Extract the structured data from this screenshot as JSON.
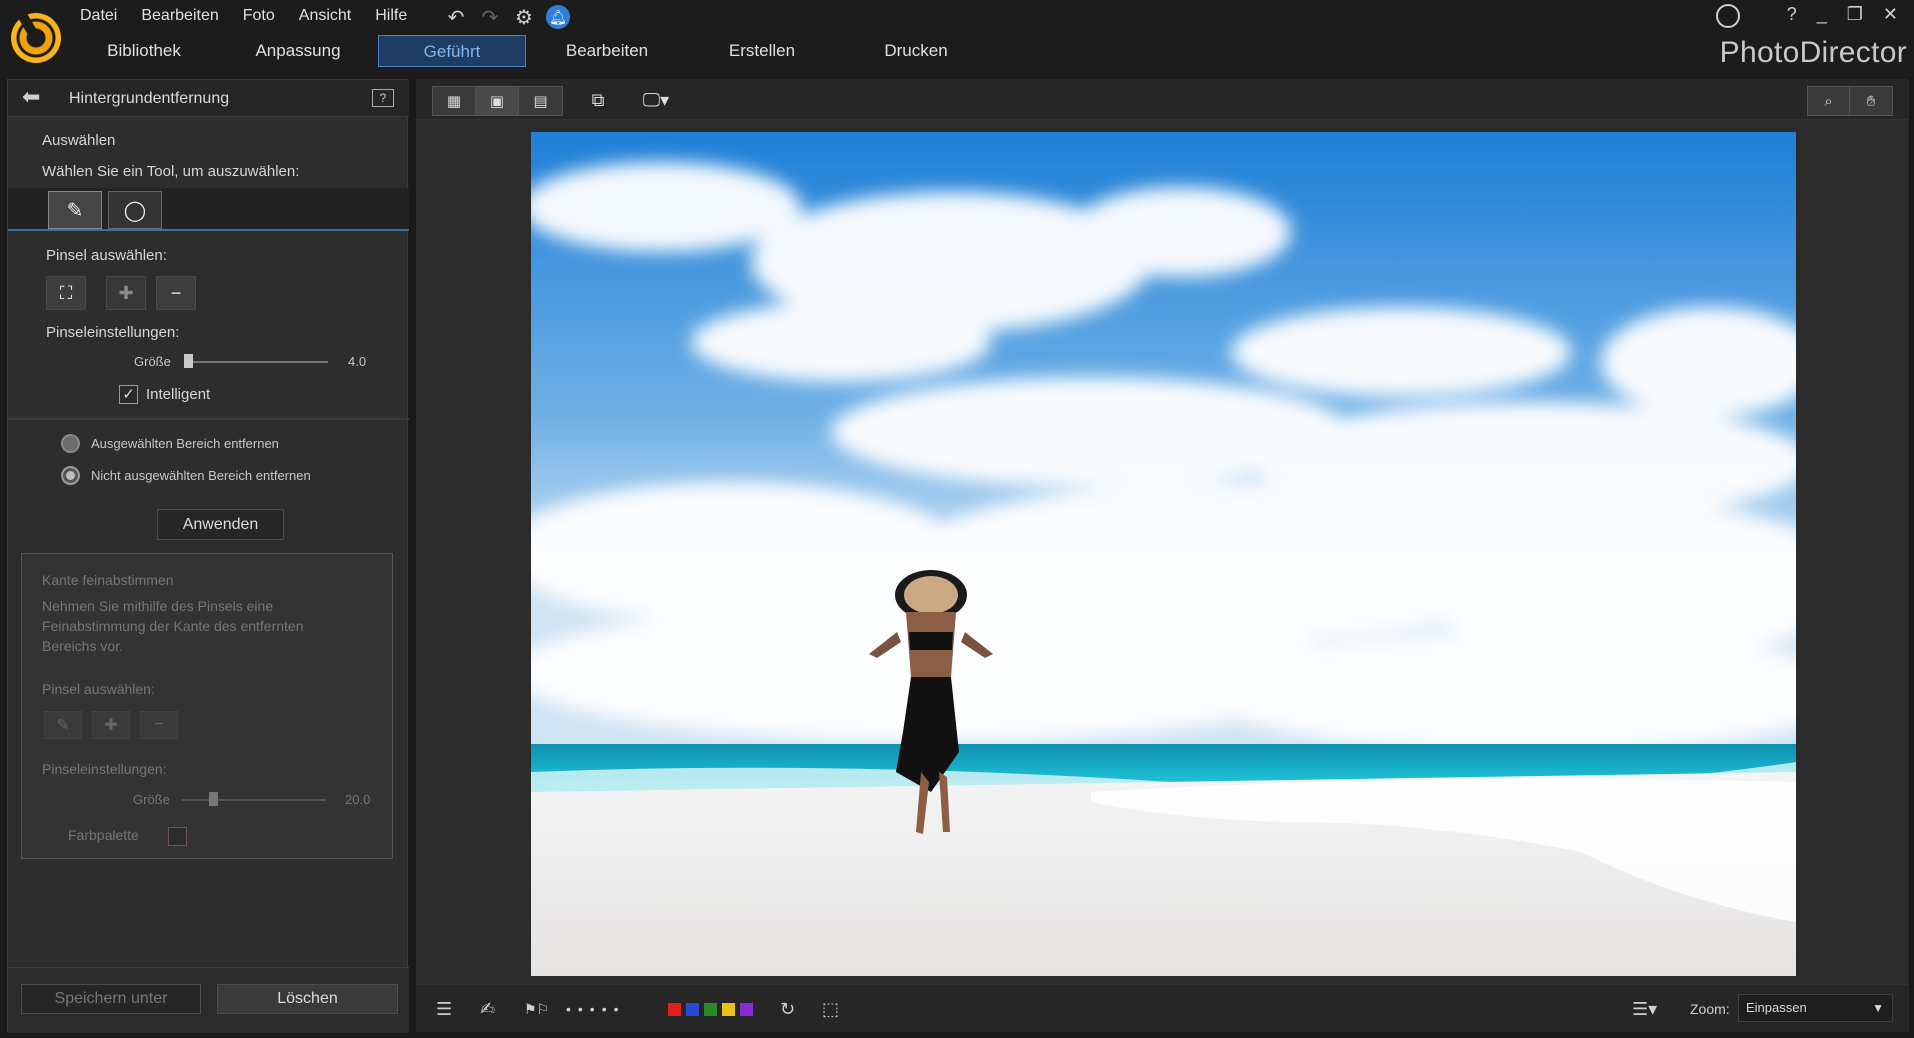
{
  "menu": [
    "Datei",
    "Bearbeiten",
    "Foto",
    "Ansicht",
    "Hilfe"
  ],
  "tabs": [
    "Bibliothek",
    "Anpassung",
    "Geführt",
    "Bearbeiten",
    "Erstellen",
    "Drucken"
  ],
  "active_tab": "Geführt",
  "brand": "PhotoDirector",
  "window_controls": [
    "?",
    "_",
    "❐",
    "✕"
  ],
  "panel": {
    "title": "Hintergrundentfernung",
    "select_heading": "Auswählen",
    "select_prompt": "Wählen Sie ein Tool, um auszuwählen:",
    "brush_select_label": "Pinsel auswählen:",
    "brush_settings_label": "Pinseleinstellungen:",
    "size_label": "Größe",
    "size_value": "4.0",
    "size_fraction": 0.0,
    "intelligent_label": "Intelligent",
    "intelligent_checked": true,
    "radio_remove_selected": "Ausgewählten Bereich entfernen",
    "radio_remove_unselected": "Nicht ausgewählten Bereich entfernen",
    "radio_selected": "remove_unselected",
    "apply_label": "Anwenden",
    "refine": {
      "title": "Kante feinabstimmen",
      "description": "Nehmen Sie mithilfe des Pinsels eine Feinabstimmung der Kante des entfernten Bereichs vor.",
      "brush_select_label": "Pinsel auswählen:",
      "brush_settings_label": "Pinseleinstellungen:",
      "size_label": "Größe",
      "size_value": "20.0",
      "size_fraction": 0.2,
      "palette_label": "Farbpalette"
    },
    "save_as_label": "Speichern unter",
    "delete_label": "Löschen"
  },
  "bottom": {
    "zoom_label": "Zoom:",
    "zoom_value": "Einpassen",
    "color_labels": [
      "#e0201a",
      "#2b49d8",
      "#2a8a2a",
      "#e8c21a",
      "#8a2ad8"
    ]
  },
  "colors": {
    "accent": "#4c86c6",
    "active_tab_bg": "#1f3d63",
    "active_tab_text": "#7fb6ef",
    "logo": "#f0a20a"
  }
}
